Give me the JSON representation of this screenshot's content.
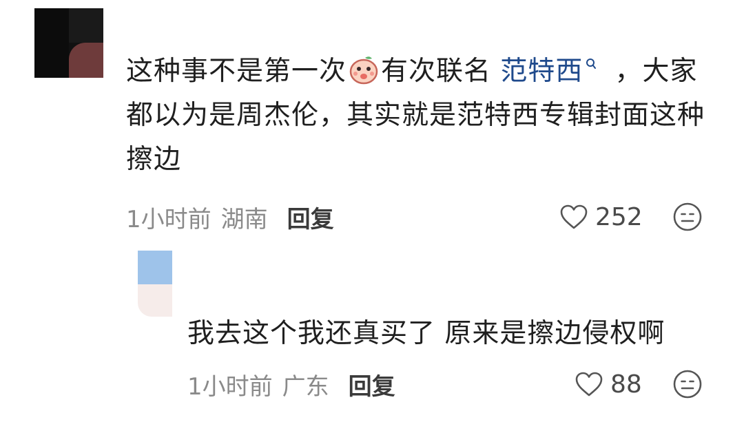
{
  "comment": {
    "text_before": "这种事不是第一次",
    "text_after_emoji": "有次联名 ",
    "link_text": "范特西",
    "text_rest": "，大家都以为是周杰伦，其实就是范特西专辑封面这种擦边",
    "time": "1小时前",
    "location": "湖南",
    "reply_label": "回复",
    "likes": "252"
  },
  "reply": {
    "text": "我去这个我还真买了 原来是擦边侵权啊",
    "time": "1小时前",
    "location": "广东",
    "reply_label": "回复",
    "likes": "88"
  }
}
